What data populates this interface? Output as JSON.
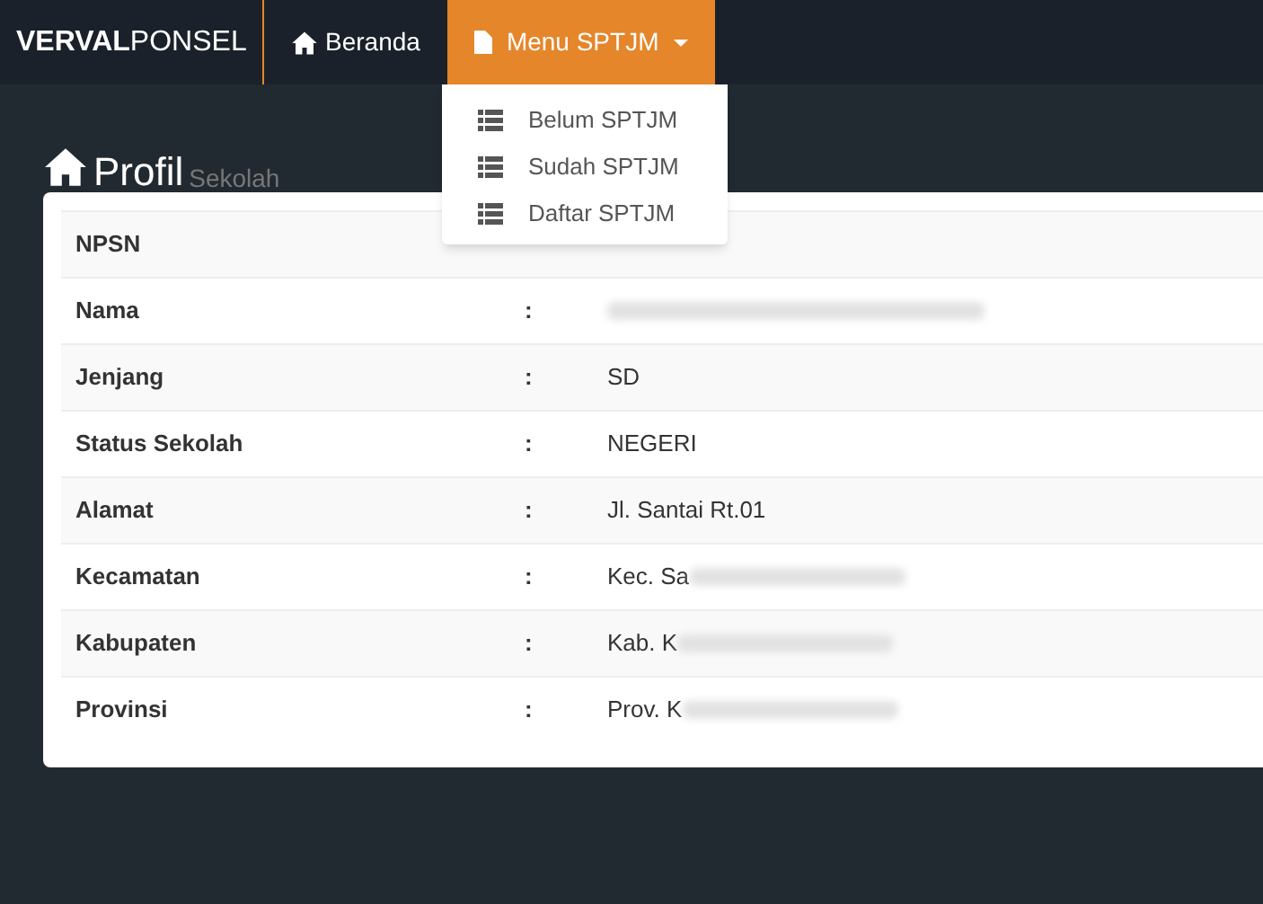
{
  "brand": {
    "bold": "VERVAL",
    "light": "PONSEL"
  },
  "nav": [
    {
      "label": "Beranda",
      "kind": "home",
      "selected": false
    },
    {
      "label": "Menu SPTJM",
      "kind": "dropdown",
      "selected": true
    }
  ],
  "dropdown": [
    "Belum SPTJM",
    "Sudah SPTJM",
    "Daftar SPTJM"
  ],
  "heading": {
    "title": "Profil",
    "subtitle": "Sekolah"
  },
  "rows": [
    {
      "label": "NPSN",
      "covered": true
    },
    {
      "label": "Nama",
      "sep": ":",
      "blurred": true
    },
    {
      "label": "Jenjang",
      "sep": ":",
      "value": "SD"
    },
    {
      "label": "Status Sekolah",
      "sep": ":",
      "value": "NEGERI"
    },
    {
      "label": "Alamat",
      "sep": ":",
      "value": "Jl. Santai Rt.01"
    },
    {
      "label": "Kecamatan",
      "sep": ":",
      "value": "Kec. Sa",
      "blurred": true
    },
    {
      "label": "Kabupaten",
      "sep": ":",
      "value": "Kab. K",
      "blurred": true
    },
    {
      "label": "Provinsi",
      "sep": ":",
      "value": "Prov. K",
      "blurred": true
    }
  ]
}
